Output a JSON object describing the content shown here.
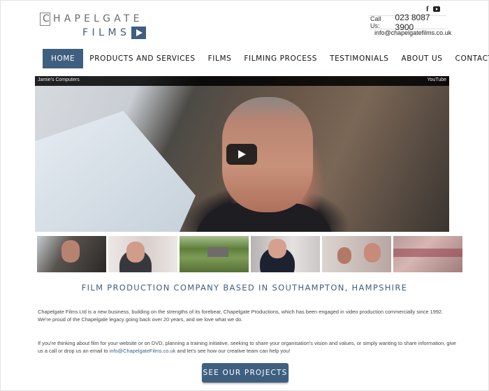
{
  "logo": {
    "line1": "CHAPELGATE",
    "line2": "FILMS"
  },
  "header": {
    "social": {
      "facebook_glyph": "f"
    },
    "call_label": "Call Us:",
    "phone": "023 8087 3900",
    "email": "info@chapelgatefilms.co.uk"
  },
  "nav": {
    "items": [
      {
        "label": "HOME",
        "active": true
      },
      {
        "label": "PRODUCTS AND SERVICES"
      },
      {
        "label": "FILMS"
      },
      {
        "label": "FILMING PROCESS"
      },
      {
        "label": "TESTIMONIALS"
      },
      {
        "label": "ABOUT US"
      },
      {
        "label": "CONTACT"
      }
    ]
  },
  "video": {
    "title": "Jamie's Computers",
    "provider": "YouTube"
  },
  "headline": "FILM PRODUCTION COMPANY BASED IN SOUTHAMPTON, HAMPSHIRE",
  "paragraph1": "Chapelgate Films Ltd is a new business, building on the strengths of its forebear, Chapelgate Productions, which has been engaged in video production commercially since 1992. We're proud of the Chapelgate legacy going back over 20 years, and we love what we do.",
  "paragraph2": {
    "before_link": "If you're thinking about film for your website or on DVD, planning a training initiative, seeking to share your organisation's vision and values, or simply wanting to share information, give us a call or drop us an email to ",
    "link": "info@ChapelgateFilms.co.uk",
    "after_link": " and let's see how our creative team can help you!"
  },
  "cta_label": "SEE OUR PROJECTS",
  "colors": {
    "brand": "#3e5f80",
    "text": "#444444"
  }
}
